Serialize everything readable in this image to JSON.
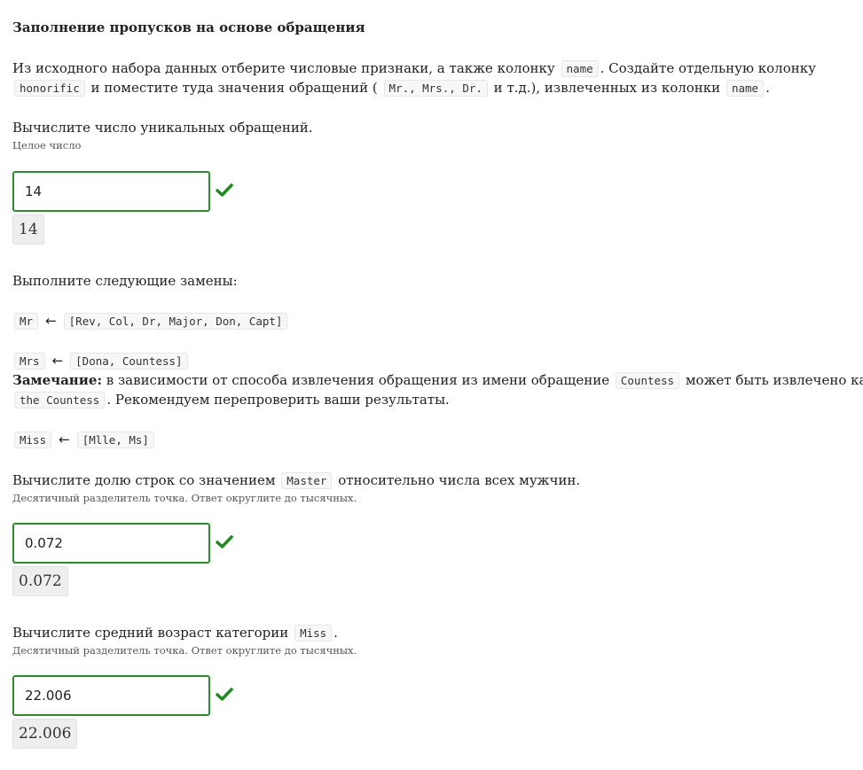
{
  "title": "Заполнение пропусков на основе обращения",
  "intro": {
    "line1_a": "Из исходного набора данных отберите числовые признаки, а также колонку",
    "line1_code": "name",
    "line1_b": ". Создайте отдельную колонку",
    "line2_code1": "honorific",
    "line2_a": "и поместите туда значения обращений (",
    "line2_code2": "Mr., Mrs., Dr.",
    "line2_b": "и т.д.), извлеченных из колонки",
    "line2_code3": "name",
    "line2_c": "."
  },
  "q1": {
    "question": "Вычислите число уникальных обращений.",
    "hint": "Целое число",
    "input_value": "14",
    "result": "14"
  },
  "replacements": {
    "intro": "Выполните следующие замены:",
    "arrow": "←",
    "r1_from": "Mr",
    "r1_to": "[Rev, Col, Dr, Major, Don, Capt]",
    "r2_from": "Mrs",
    "r2_to": "[Dona, Countess]",
    "note_bold": "Замечание:",
    "note_a": "в зависимости от способа извлечения обращения из имени обращение",
    "note_code1": "Countess",
    "note_b": "может быть извлечено как",
    "note_code2": "the Countess",
    "note_c": ". Рекомендуем перепроверить ваши результаты.",
    "r3_from": "Miss",
    "r3_to": "[Mlle, Ms]"
  },
  "q2": {
    "question_a": "Вычислите долю строк со значением",
    "question_code": "Master",
    "question_b": "относительно числа всех мужчин.",
    "hint": "Десятичный разделитель точка. Ответ округлите до тысячных.",
    "input_value": "0.072",
    "result": "0.072"
  },
  "q3": {
    "question_a": "Вычислите средний возраст категории",
    "question_code": "Miss",
    "question_b": ".",
    "hint": "Десятичный разделитель точка. Ответ округлите до тысячных.",
    "input_value": "22.006",
    "result": "22.006"
  },
  "colors": {
    "correct": "#2e8a2e",
    "check": "#1f8a1f"
  },
  "icons": {
    "correct": "check-icon"
  }
}
